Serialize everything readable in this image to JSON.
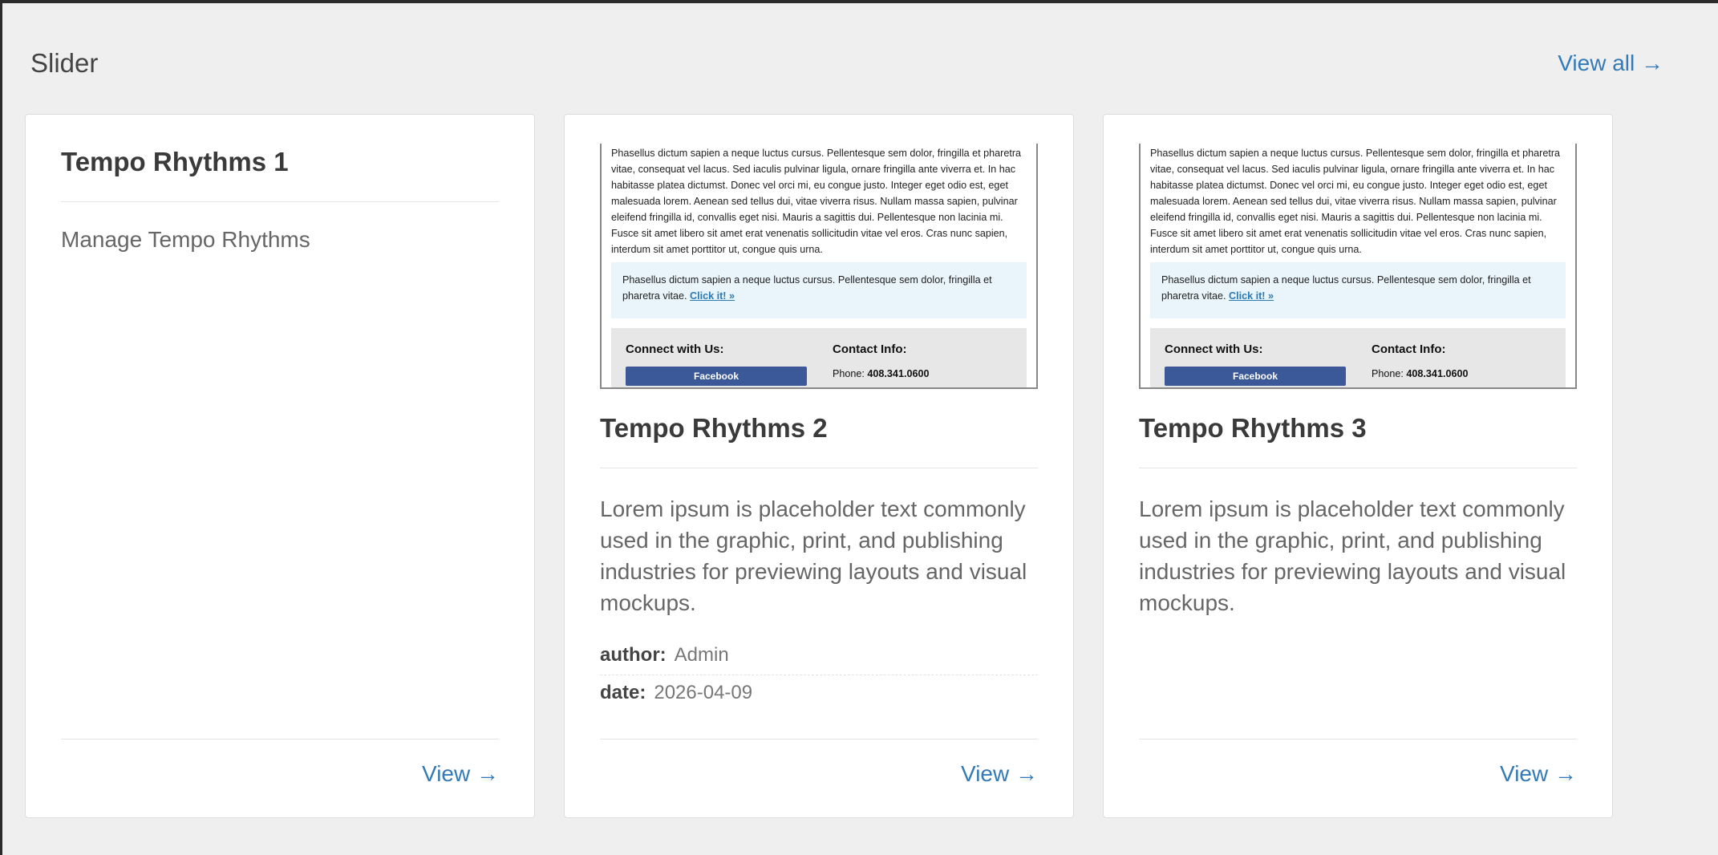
{
  "section": {
    "title": "Slider",
    "view_all": "View all →"
  },
  "cards": [
    {
      "title": "Tempo Rhythms 1",
      "description": "Manage Tempo Rhythms",
      "view_label": "View →"
    },
    {
      "title": "Tempo Rhythms 2",
      "description": "Lorem ipsum is placeholder text commonly used in the graphic, print, and publishing industries for previewing layouts and visual mockups.",
      "author_label": "author:",
      "author": "Admin",
      "date_label": "date:",
      "date": "2026-04-09",
      "view_label": "View →"
    },
    {
      "title": "Tempo Rhythms 3",
      "description": "Lorem ipsum is placeholder text commonly used in the graphic, print, and publishing industries for previewing layouts and visual mockups.",
      "view_label": "View →"
    }
  ],
  "thumbnail": {
    "paragraph": "Phasellus dictum sapien a neque luctus cursus. Pellentesque sem dolor, fringilla et pharetra vitae, consequat vel lacus. Sed iaculis pulvinar ligula, ornare fringilla ante viverra et. In hac habitasse platea dictumst. Donec vel orci mi, eu congue justo. Integer eget odio est, eget malesuada lorem. Aenean sed tellus dui, vitae viverra risus. Nullam massa sapien, pulvinar eleifend fringilla id, convallis eget nisi. Mauris a sagittis dui. Pellentesque non lacinia mi. Fusce sit amet libero sit amet erat venenatis sollicitudin vitae vel eros. Cras nunc sapien, interdum sit amet porttitor ut, congue quis urna.",
    "box_text": "Phasellus dictum sapien a neque luctus cursus. Pellentesque sem dolor, fringilla et pharetra vitae.",
    "box_link": "Click it! »",
    "connect_label": "Connect with Us:",
    "facebook_label": "Facebook",
    "contact_label": "Contact Info:",
    "phone_label": "Phone:",
    "phone": "408.341.0600"
  },
  "colors": {
    "link": "#337ab7",
    "background": "#efefef",
    "facebook": "#3b5998"
  }
}
